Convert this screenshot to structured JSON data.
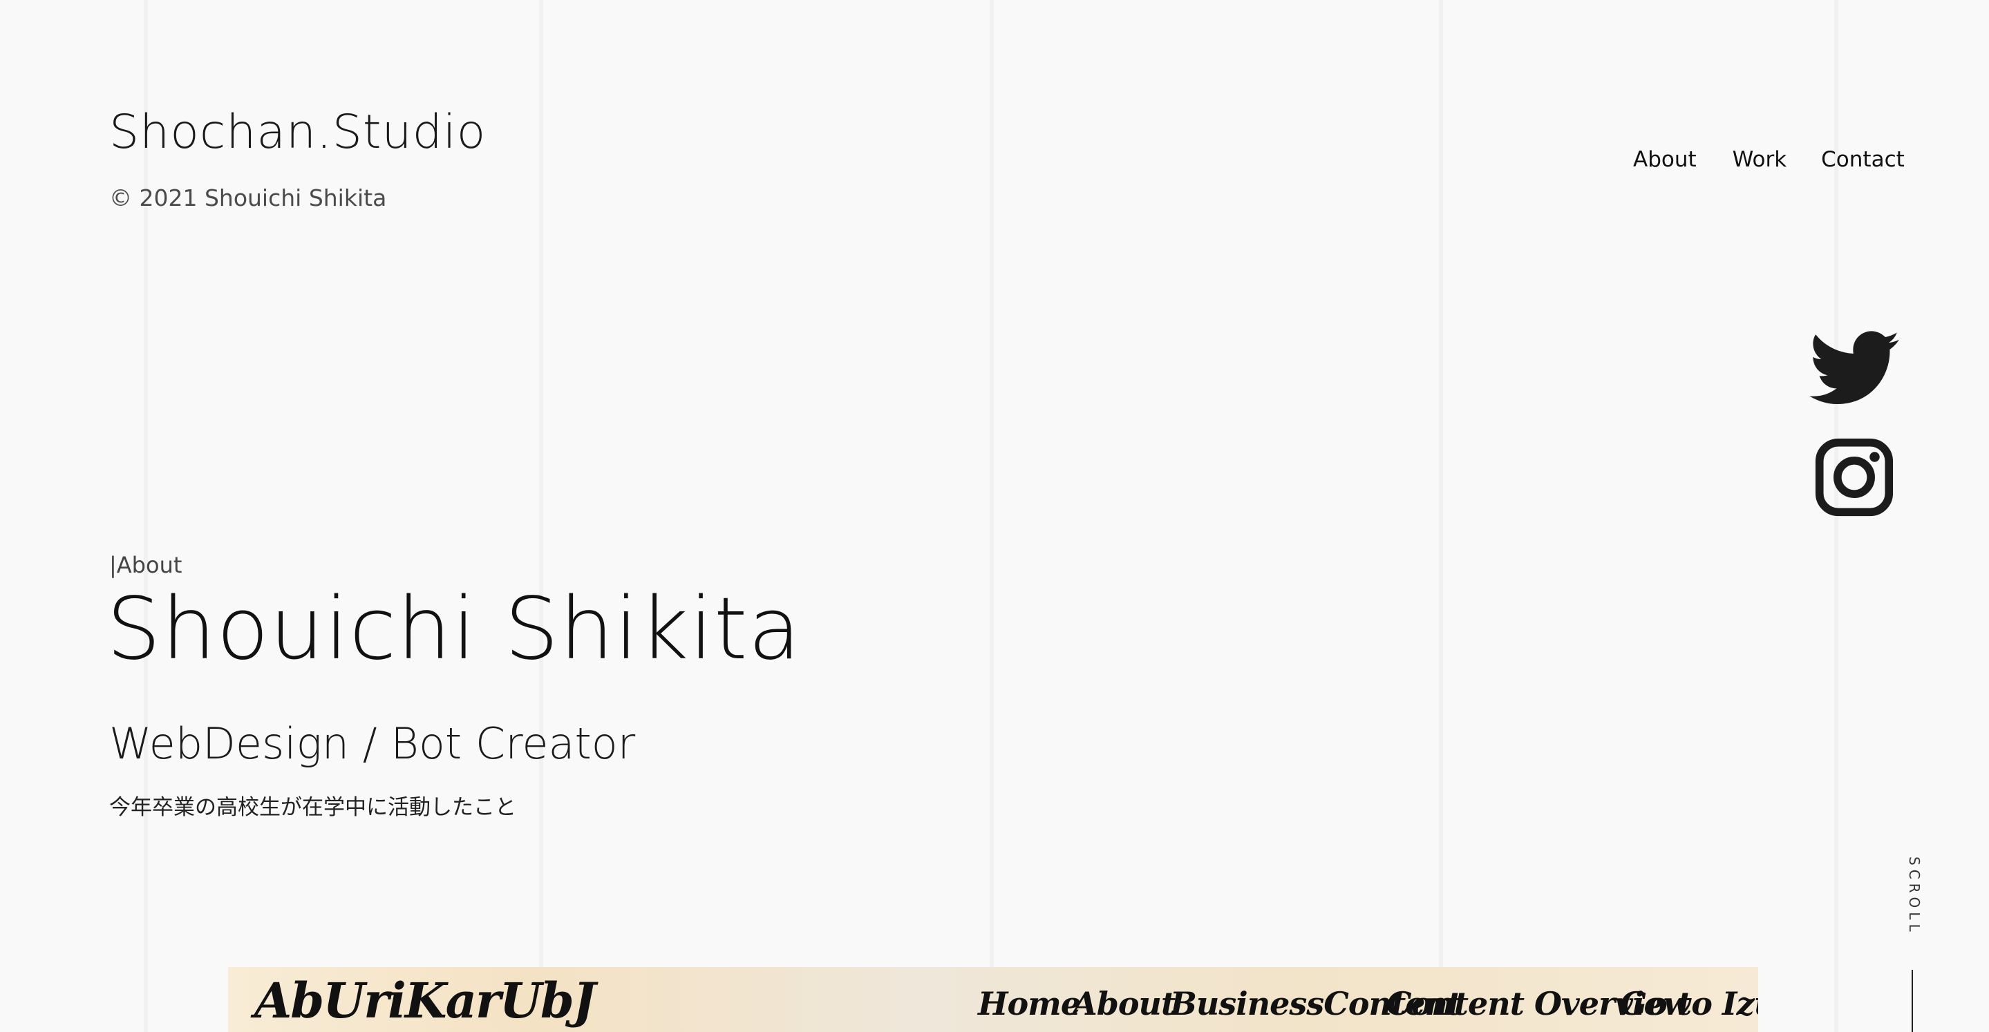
{
  "header": {
    "brand": "Shochan.Studio",
    "copyright": "© 2021 Shouichi Shikita",
    "nav": [
      "About",
      "Work",
      "Contact"
    ]
  },
  "social": {
    "twitter_icon": "twitter-bird-icon",
    "instagram_icon": "instagram-icon",
    "icon_color": "#1c1c1c"
  },
  "hero": {
    "section_label": "|About",
    "name": "Shouichi Shikita",
    "role": "WebDesign / Bot Creator",
    "description": "今年卒業の高校生が在学中に活動したこと"
  },
  "scroll": {
    "label": "SCROLL"
  },
  "preview": {
    "logo": "AbUriKarUbJ",
    "nav": [
      "Home",
      "About",
      "BusinessContent",
      "Content Overview",
      "Go to Izu"
    ]
  },
  "colors": {
    "background": "#f9f9f9",
    "text": "#1c1c1c"
  }
}
